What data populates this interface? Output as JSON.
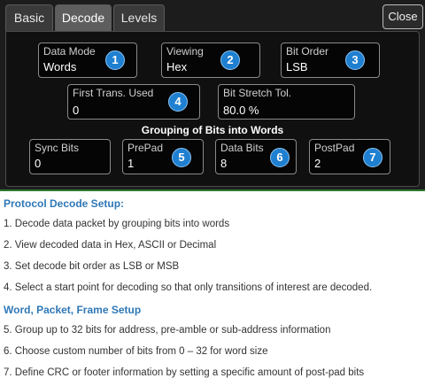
{
  "tabs": {
    "basic": "Basic",
    "decode": "Decode",
    "levels": "Levels",
    "active": "Decode"
  },
  "close_label": "Close",
  "fields": {
    "data_mode": {
      "label": "Data Mode",
      "value": "Words",
      "badge": "1"
    },
    "viewing": {
      "label": "Viewing",
      "value": "Hex",
      "badge": "2"
    },
    "bit_order": {
      "label": "Bit Order",
      "value": "LSB",
      "badge": "3"
    },
    "first_trans_used": {
      "label": "First Trans. Used",
      "value": "0",
      "badge": "4"
    },
    "bit_stretch_tol": {
      "label": "Bit Stretch Tol.",
      "value": "80.0 %"
    },
    "sync_bits": {
      "label": "Sync Bits",
      "value": "0"
    },
    "prepad": {
      "label": "PrePad",
      "value": "1",
      "badge": "5"
    },
    "data_bits": {
      "label": "Data Bits",
      "value": "8",
      "badge": "6"
    },
    "postpad": {
      "label": "PostPad",
      "value": "2",
      "badge": "7"
    }
  },
  "group_heading": "Grouping of Bits into Words",
  "description": {
    "heading1": "Protocol Decode Setup:",
    "items1": [
      "1. Decode data packet by grouping bits into words",
      "2. View decoded data in Hex, ASCII or Decimal",
      "3. Set decode bit order as LSB or MSB",
      "4. Select a start point for decoding so that only  transitions of interest are decoded."
    ],
    "heading2": "Word, Packet, Frame Setup",
    "items2": [
      "5. Group up to 32 bits for address, pre-amble or sub-address information",
      "6. Choose custom number of bits from 0 – 32 for word size",
      "7. Define CRC or footer information by setting a specific amount of post-pad bits"
    ]
  },
  "colors": {
    "dialog_bg": "#1c1c1c",
    "panel_bg": "#101010",
    "badge_blue": "#1f7fd0",
    "heading_blue": "#2f78b7",
    "accent_green": "#2e7a2e"
  }
}
